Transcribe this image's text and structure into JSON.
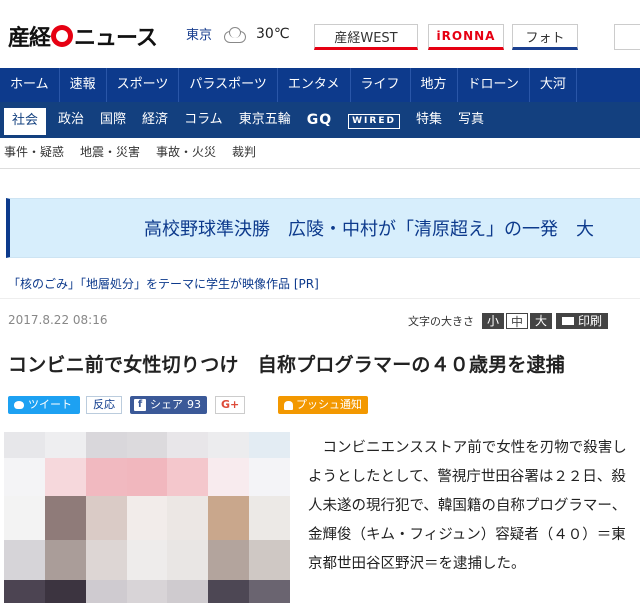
{
  "header": {
    "logo_left": "産経",
    "logo_right": "ニュース",
    "weather_city": "東京",
    "weather_icon": "cloud-icon",
    "temperature": "30℃",
    "links": [
      {
        "label": "産経WEST"
      },
      {
        "label": "iRONNA"
      },
      {
        "label": "フォト"
      }
    ]
  },
  "nav_primary": [
    "ホーム",
    "速報",
    "スポーツ",
    "パラスポーツ",
    "エンタメ",
    "ライフ",
    "地方",
    "ドローン",
    "大河"
  ],
  "nav_secondary": [
    "社会",
    "政治",
    "国際",
    "経済",
    "コラム",
    "東京五輪",
    "GQ",
    "WIRED",
    "特集",
    "写真"
  ],
  "nav_secondary_active": "社会",
  "subnav": [
    "事件・疑惑",
    "地震・災害",
    "事故・火災",
    "裁判"
  ],
  "banner": {
    "text": "高校野球準決勝　広陵・中村が「清原超え」の一発　大"
  },
  "promo": {
    "text": "「核のごみ」「地層処分」をテーマに学生が映像作品  [PR]"
  },
  "article": {
    "date": "2017.8.22 08:16",
    "font_size_label": "文字の大きさ",
    "font_small": "小",
    "font_medium": "中",
    "font_large": "大",
    "print_label": "印刷",
    "headline": "コンビニ前で女性切りつけ　自称プログラマーの４０歳男を逮捕",
    "share": {
      "tweet": "ツイート",
      "react": "反応",
      "facebook": "シェア",
      "facebook_count": "93",
      "gplus": "G+",
      "push": "プッシュ通知"
    },
    "body": "　コンビニエンスストア前で女性を刃物で殺害しようとしたとして、警視庁世田谷署は２２日、殺人未遂の現行犯で、韓国籍の自称プログラマー、金輝俊（キム・フィジュン）容疑者（４０）＝東京都世田谷区野沢＝を逮捕した。"
  },
  "colors": {
    "nav_primary": "#0d3a8c",
    "nav_secondary": "#13407f",
    "banner_bg": "#d7eefc",
    "accent_red": "#e60012",
    "twitter": "#1da1f2",
    "facebook": "#3b5998",
    "push": "#f39800"
  },
  "mosaic_colors": [
    [
      "#e7e7ea",
      "#eeeef0",
      "#d9d7db",
      "#dcdadd",
      "#e8e6e9",
      "#ececee",
      "#e3ecf3"
    ],
    [
      "#f4f4f6",
      "#f6d8dc",
      "#f1b9c0",
      "#f1b7be",
      "#f4c7cc",
      "#f8ebee",
      "#f4f4f7"
    ],
    [
      "#f3f3f3",
      "#8f7b79",
      "#dacbc6",
      "#f2ecea",
      "#ece7e4",
      "#c9a78c",
      "#ece9e6"
    ],
    [
      "#d6d4d8",
      "#aa9d99",
      "#ddd6d4",
      "#eeeceb",
      "#e9e6e4",
      "#b3a49d",
      "#cfc8c4"
    ],
    [
      "#4c4452",
      "#3c3440",
      "#cfcbd0",
      "#d8d4d7",
      "#cfcbcf",
      "#4d4754",
      "#6a6470"
    ]
  ]
}
